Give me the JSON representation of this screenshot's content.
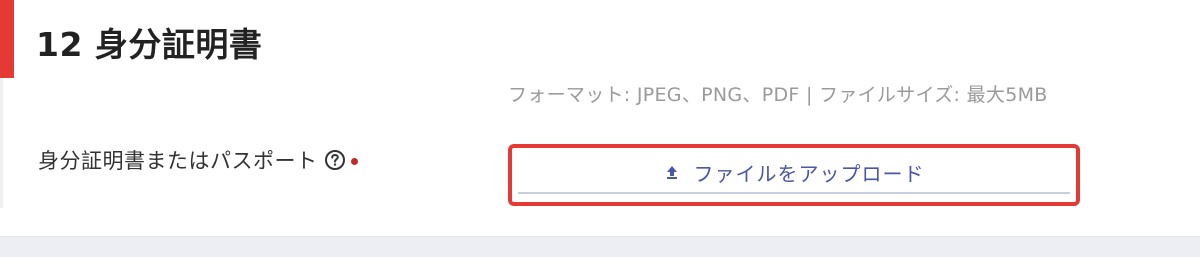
{
  "section": {
    "title": "12 身分証明書"
  },
  "upload_hint": "フォーマット: JPEG、PNG、PDF | ファイルサイズ: 最大5MB",
  "field": {
    "label": "身分証明書またはパスポート",
    "help_icon": "question-circle-icon",
    "required": true
  },
  "upload": {
    "icon": "upload-arrow-icon",
    "label": "ファイルをアップロード"
  },
  "colors": {
    "accent": "#e53935",
    "required_dot": "#c62828",
    "upload_text": "#4a56a6",
    "hint_text": "#9a9a9a"
  }
}
